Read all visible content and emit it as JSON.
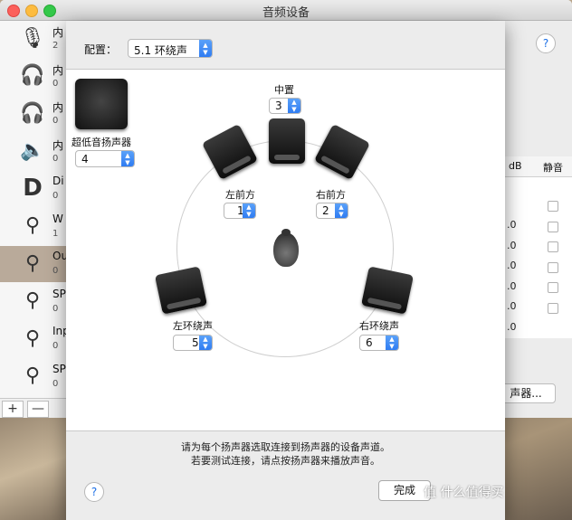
{
  "window": {
    "title": "音频设备"
  },
  "sidebar": {
    "items": [
      {
        "name": "内",
        "sub": "2",
        "icon": "microphone-icon",
        "glyph": "🎙"
      },
      {
        "name": "内",
        "sub": "0",
        "icon": "headphones-icon",
        "glyph": "🎧"
      },
      {
        "name": "内",
        "sub": "0",
        "icon": "headphones-icon",
        "glyph": "🎧"
      },
      {
        "name": "内",
        "sub": "0",
        "icon": "speaker-icon",
        "glyph": "🔈"
      },
      {
        "name": "Di",
        "sub": "0",
        "icon": "displayport-icon",
        "glyph": "D"
      },
      {
        "name": "W",
        "sub": "1",
        "icon": "usb-icon",
        "glyph": "⚲"
      },
      {
        "name": "Ou",
        "sub": "0",
        "icon": "usb-icon",
        "glyph": "⚲"
      },
      {
        "name": "SP",
        "sub": "0",
        "icon": "usb-icon",
        "glyph": "⚲"
      },
      {
        "name": "Inp",
        "sub": "0",
        "icon": "usb-icon",
        "glyph": "⚲"
      },
      {
        "name": "SP",
        "sub": "0",
        "icon": "usb-icon",
        "glyph": "⚲"
      }
    ],
    "add_label": "+",
    "remove_label": "—"
  },
  "right_panel": {
    "help": "?",
    "col_db": "dB",
    "col_mute": "静音",
    "values": [
      ".0",
      ".0",
      ".0",
      ".0",
      ".0",
      ".0"
    ],
    "config_button": "声器..."
  },
  "sheet": {
    "config_label": "配置：",
    "config_value": "5.1 环绕声",
    "subwoofer": {
      "label": "超低音扬声器",
      "channel": "4"
    },
    "center": {
      "label": "中置",
      "channel": "3"
    },
    "front_left": {
      "label": "左前方",
      "channel": "1"
    },
    "front_right": {
      "label": "右前方",
      "channel": "2"
    },
    "surround_left": {
      "label": "左环绕声",
      "channel": "5"
    },
    "surround_right": {
      "label": "右环绕声",
      "channel": "6"
    },
    "instruction_line1": "请为每个扬声器选取连接到扬声器的设备声道。",
    "instruction_line2": "若要测试连接，请点按扬声器来播放声音。",
    "help": "?",
    "done_label": "完成"
  },
  "watermark": "值 什么值得买"
}
